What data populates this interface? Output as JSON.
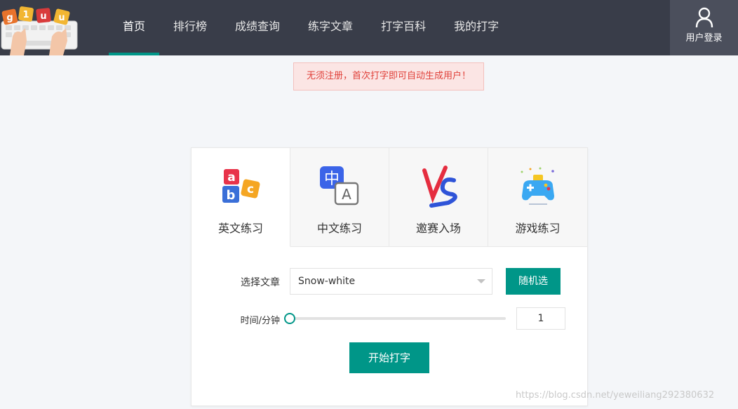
{
  "header": {
    "logo_icon": "typing-keyboard-logo",
    "logo_letters": [
      "g",
      "1",
      "u",
      "u"
    ],
    "nav": [
      {
        "label": "首页",
        "active": true
      },
      {
        "label": "排行榜"
      },
      {
        "label": "成绩查询"
      },
      {
        "label": "练字文章"
      },
      {
        "label": "打字百科"
      },
      {
        "label": "我的打字"
      }
    ],
    "login": {
      "icon": "user-icon",
      "label": "用户登录"
    }
  },
  "notice": "无须注册，首次打字即可自动生成用户！",
  "practice": {
    "tabs": [
      {
        "label": "英文练习",
        "icon": "abc-puzzle-icon",
        "active": true
      },
      {
        "label": "中文练习",
        "icon": "translate-zh-a-icon"
      },
      {
        "label": "邀赛入场",
        "icon": "vs-icon"
      },
      {
        "label": "游戏练习",
        "icon": "gamepad-icon"
      }
    ],
    "article_label": "选择文章",
    "article_value": "Snow-white",
    "random_button": "随机选",
    "time_label": "时间/分钟",
    "time_value": "1",
    "start_button": "开始打字"
  },
  "watermark": "https://blog.csdn.net/yeweiliang292380632",
  "colors": {
    "topbar": "#393d49",
    "accent": "#009688",
    "notice_text": "#e0413a",
    "notice_bg": "#fbe5e4"
  }
}
